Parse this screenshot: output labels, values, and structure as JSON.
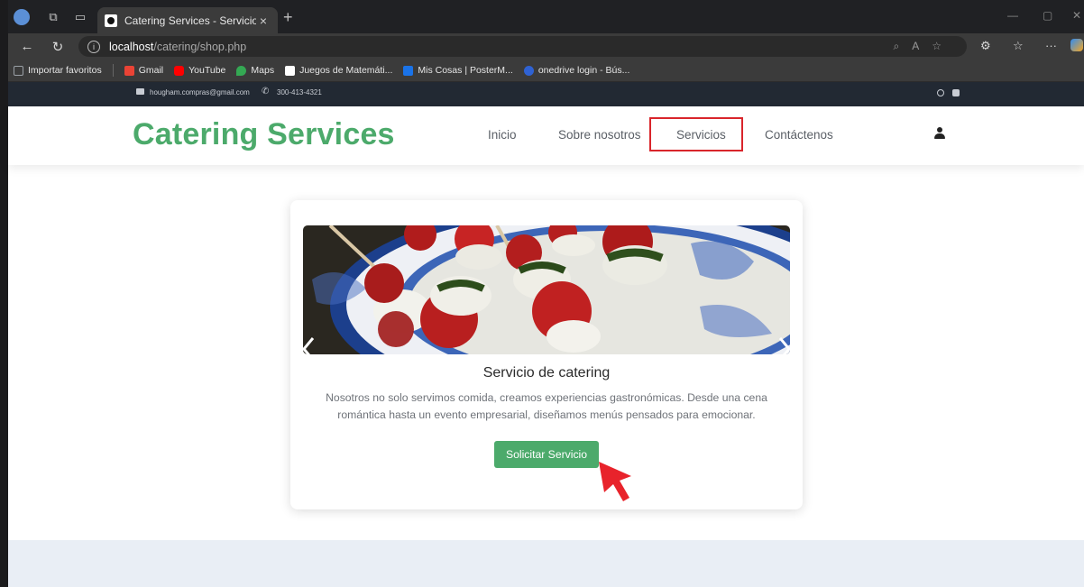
{
  "browser": {
    "tab_title": "Catering Services - Servicios",
    "tab_close": "×",
    "new_tab": "+",
    "url_host": "localhost",
    "url_path": "/catering/shop.php",
    "url_info": "i",
    "window_minimize": "—",
    "window_restore": "▢",
    "window_close": "✕",
    "bookmarks": [
      {
        "label": "Importar favoritos",
        "color": "#9aa0a6"
      },
      {
        "label": "Gmail",
        "color": "#ea4335"
      },
      {
        "label": "YouTube",
        "color": "#ff0000"
      },
      {
        "label": "Maps",
        "color": "#34a853"
      },
      {
        "label": "Juegos de Matemáti...",
        "color": "#ffffff"
      },
      {
        "label": "Mis Cosas | PosterM...",
        "color": "#1a73e8"
      },
      {
        "label": "onedrive login - Bús...",
        "color": "#2f62d3"
      }
    ]
  },
  "topbar": {
    "email": "hougham.compras@gmail.com",
    "phone": "300-413-4321"
  },
  "site": {
    "brand": "Catering Services",
    "nav": [
      {
        "label": "Inicio"
      },
      {
        "label": "Sobre nosotros"
      },
      {
        "label": "Servicios"
      },
      {
        "label": "Contáctenos"
      }
    ],
    "active_nav": "Servicios",
    "accent_color": "#4caa6b",
    "highlight_color": "#d9252b"
  },
  "card": {
    "title": "Servicio de catering",
    "description": "Nosotros no solo servimos comida, creamos experiencias gastronómicas. Desde una cena romántica hasta un evento empresarial, diseñamos menús pensados para emocionar.",
    "button_label": "Solicitar Servicio",
    "image_name": "caprese-skewers-photo"
  }
}
